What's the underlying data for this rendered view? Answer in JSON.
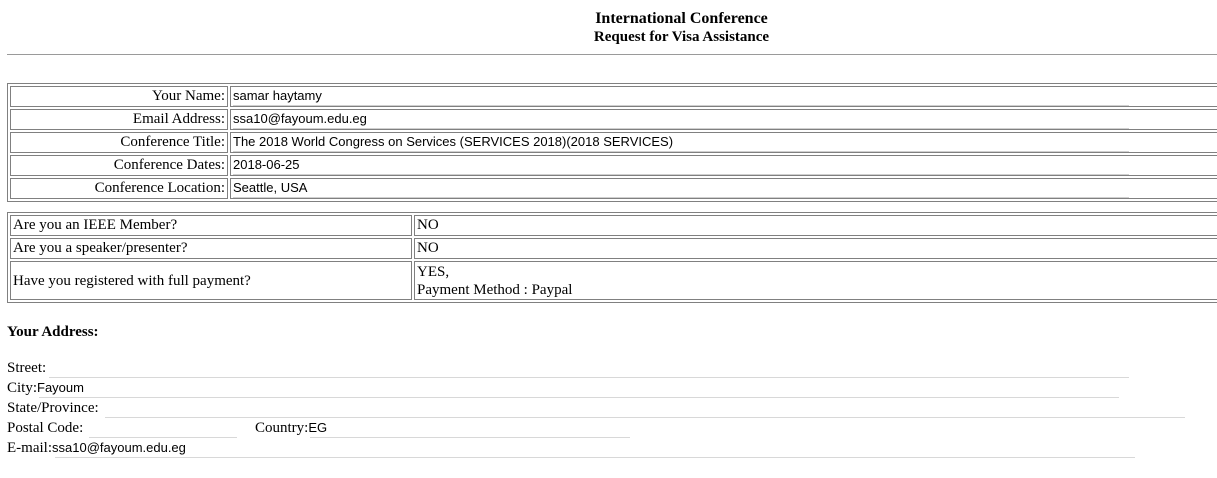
{
  "header": {
    "title": "International Conference",
    "subtitle": "Request for Visa Assistance"
  },
  "info": {
    "name_label": "Your Name:",
    "name_value": "samar haytamy",
    "email_label": "Email Address:",
    "email_value": "ssa10@fayoum.edu.eg",
    "conf_title_label": "Conference Title:",
    "conf_title_value": "The 2018 World Congress on Services (SERVICES 2018)(2018 SERVICES)",
    "conf_dates_label": "Conference Dates:",
    "conf_dates_value": "2018-06-25",
    "conf_location_label": "Conference Location:",
    "conf_location_value": "Seattle, USA"
  },
  "questions": {
    "ieee_q": "Are you an IEEE Member?",
    "ieee_a": "NO",
    "speaker_q": "Are you a speaker/presenter?",
    "speaker_a": "NO",
    "registered_q": "Have you registered with full payment?",
    "registered_a": "YES,",
    "payment_method": "Payment Method : Paypal"
  },
  "address": {
    "heading": "Your Address:",
    "street_label": "Street:",
    "street_value": "",
    "city_label": "City:",
    "city_value": "Fayoum",
    "state_label": "State/Province:",
    "state_value": "",
    "postal_label": "Postal Code:",
    "postal_value": "",
    "country_label": "Country:",
    "country_value": "EG",
    "email_label": "E-mail:",
    "email_value": "ssa10@fayoum.edu.eg"
  }
}
